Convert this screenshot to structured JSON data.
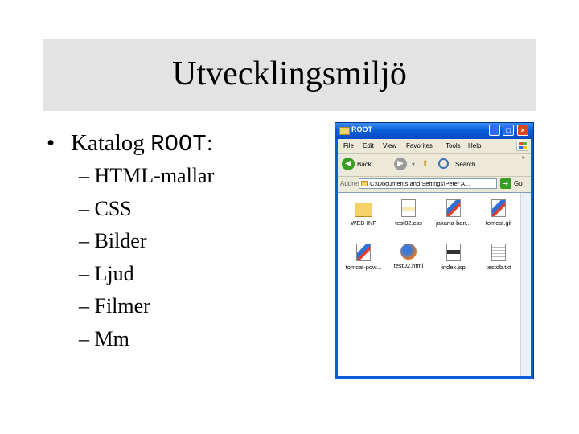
{
  "slide": {
    "title": "Utvecklingsmiljö",
    "bullet_prefix": "Katalog ",
    "bullet_code": "ROOT",
    "bullet_suffix": ":",
    "sub_items": [
      "– HTML-mallar",
      "– CSS",
      "– Bilder",
      "– Ljud",
      "– Filmer",
      "– Mm"
    ]
  },
  "window": {
    "title": "ROOT",
    "menu": [
      "File",
      "Edit",
      "View",
      "Favorites",
      "Tools",
      "Help"
    ],
    "toolbar": {
      "back": "Back",
      "search": "Search"
    },
    "address_label": "Address",
    "address_value": "C:\\Documents and Settings\\Peter A...",
    "go_label": "Go",
    "files": [
      {
        "name": "WEB-INF",
        "icon": "folder-icon"
      },
      {
        "name": "test02.css",
        "icon": "css-file-icon"
      },
      {
        "name": "jakarta-ban...",
        "icon": "image-file-icon"
      },
      {
        "name": "tomcat.gif",
        "icon": "image-file-icon"
      },
      {
        "name": "tomcat-pow...",
        "icon": "image-file-icon"
      },
      {
        "name": "test02.html",
        "icon": "firefox-html-icon"
      },
      {
        "name": "index.jsp",
        "icon": "jsp-file-icon"
      },
      {
        "name": "testdb.txt",
        "icon": "text-file-icon"
      }
    ]
  },
  "colors": {
    "title_band": "#e3e3e3",
    "xp_blue": "#0a5fd6",
    "xp_close": "#d9471e"
  }
}
